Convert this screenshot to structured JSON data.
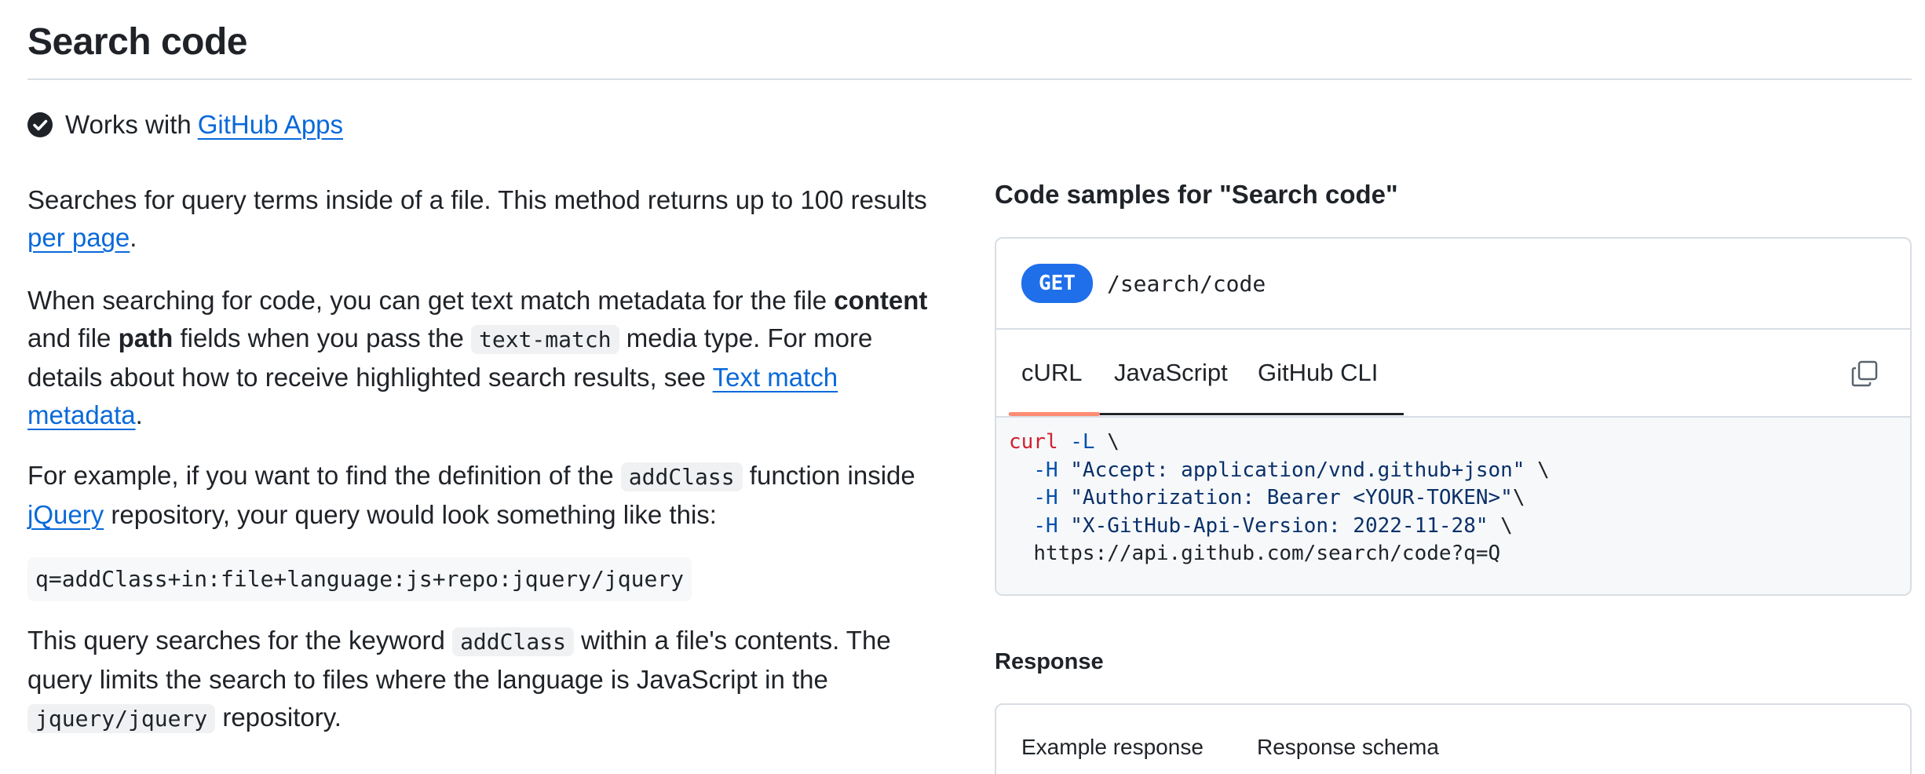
{
  "page": {
    "title": "Search code"
  },
  "works_with": {
    "text": "Works with",
    "link": "GitHub Apps"
  },
  "description": {
    "p1": {
      "text1": "Searches for query terms inside of a file. This method returns up to 100 results",
      "link": "per page",
      "text2": "."
    },
    "p2": {
      "t1": "When searching for code, you can get text match metadata for the file",
      "b1": "content",
      "t2": "and file",
      "b2": "path",
      "t3": "fields when you pass the",
      "code1": "text-match",
      "t4": "media type. For more details about how to receive highlighted search results, see",
      "link": "Text match metadata",
      "t5": "."
    },
    "p3": {
      "t1": "For example, if you want to find the definition of the",
      "code1": "addClass",
      "t2": "function inside",
      "link": "jQuery",
      "t3": "repository, your query would look something like this:"
    },
    "query_example": "q=addClass+in:file+language:js+repo:jquery/jquery",
    "p5": {
      "t1": "This query searches for the keyword",
      "code1": "addClass",
      "t2": "within a file's contents. The query limits the search to files where the language is JavaScript in the",
      "code2": "jquery/jquery",
      "t3": "repository."
    }
  },
  "code_samples": {
    "heading": "Code samples for \"Search code\"",
    "method": "GET",
    "path": "/search/code",
    "tabs": [
      {
        "label": "cURL",
        "active": true
      },
      {
        "label": "JavaScript",
        "active": false
      },
      {
        "label": "GitHub CLI",
        "active": false
      }
    ],
    "copy_icon": "copy-icon",
    "code": {
      "l1_cmd": "curl",
      "l1_flag": "-L",
      "l1_rest": " \\",
      "l2_flag": "-H",
      "l2_str": "\"Accept: application/vnd.github+json\"",
      "l2_rest": " \\",
      "l3_flag": "-H",
      "l3_str": "\"Authorization: Bearer <YOUR-TOKEN>\"",
      "l3_rest": "\\",
      "l4_flag": "-H",
      "l4_str": "\"X-GitHub-Api-Version: 2022-11-28\"",
      "l4_rest": " \\",
      "l5_url": "https://api.github.com/search/code?q=Q"
    }
  },
  "response": {
    "heading": "Response",
    "tabs": [
      {
        "label": "Example response"
      },
      {
        "label": "Response schema"
      }
    ]
  },
  "colors": {
    "link": "#0969da",
    "badge": "#1f6feb",
    "active_tab_accent": "#fd8c73",
    "code_bg": "#f6f8fa"
  }
}
